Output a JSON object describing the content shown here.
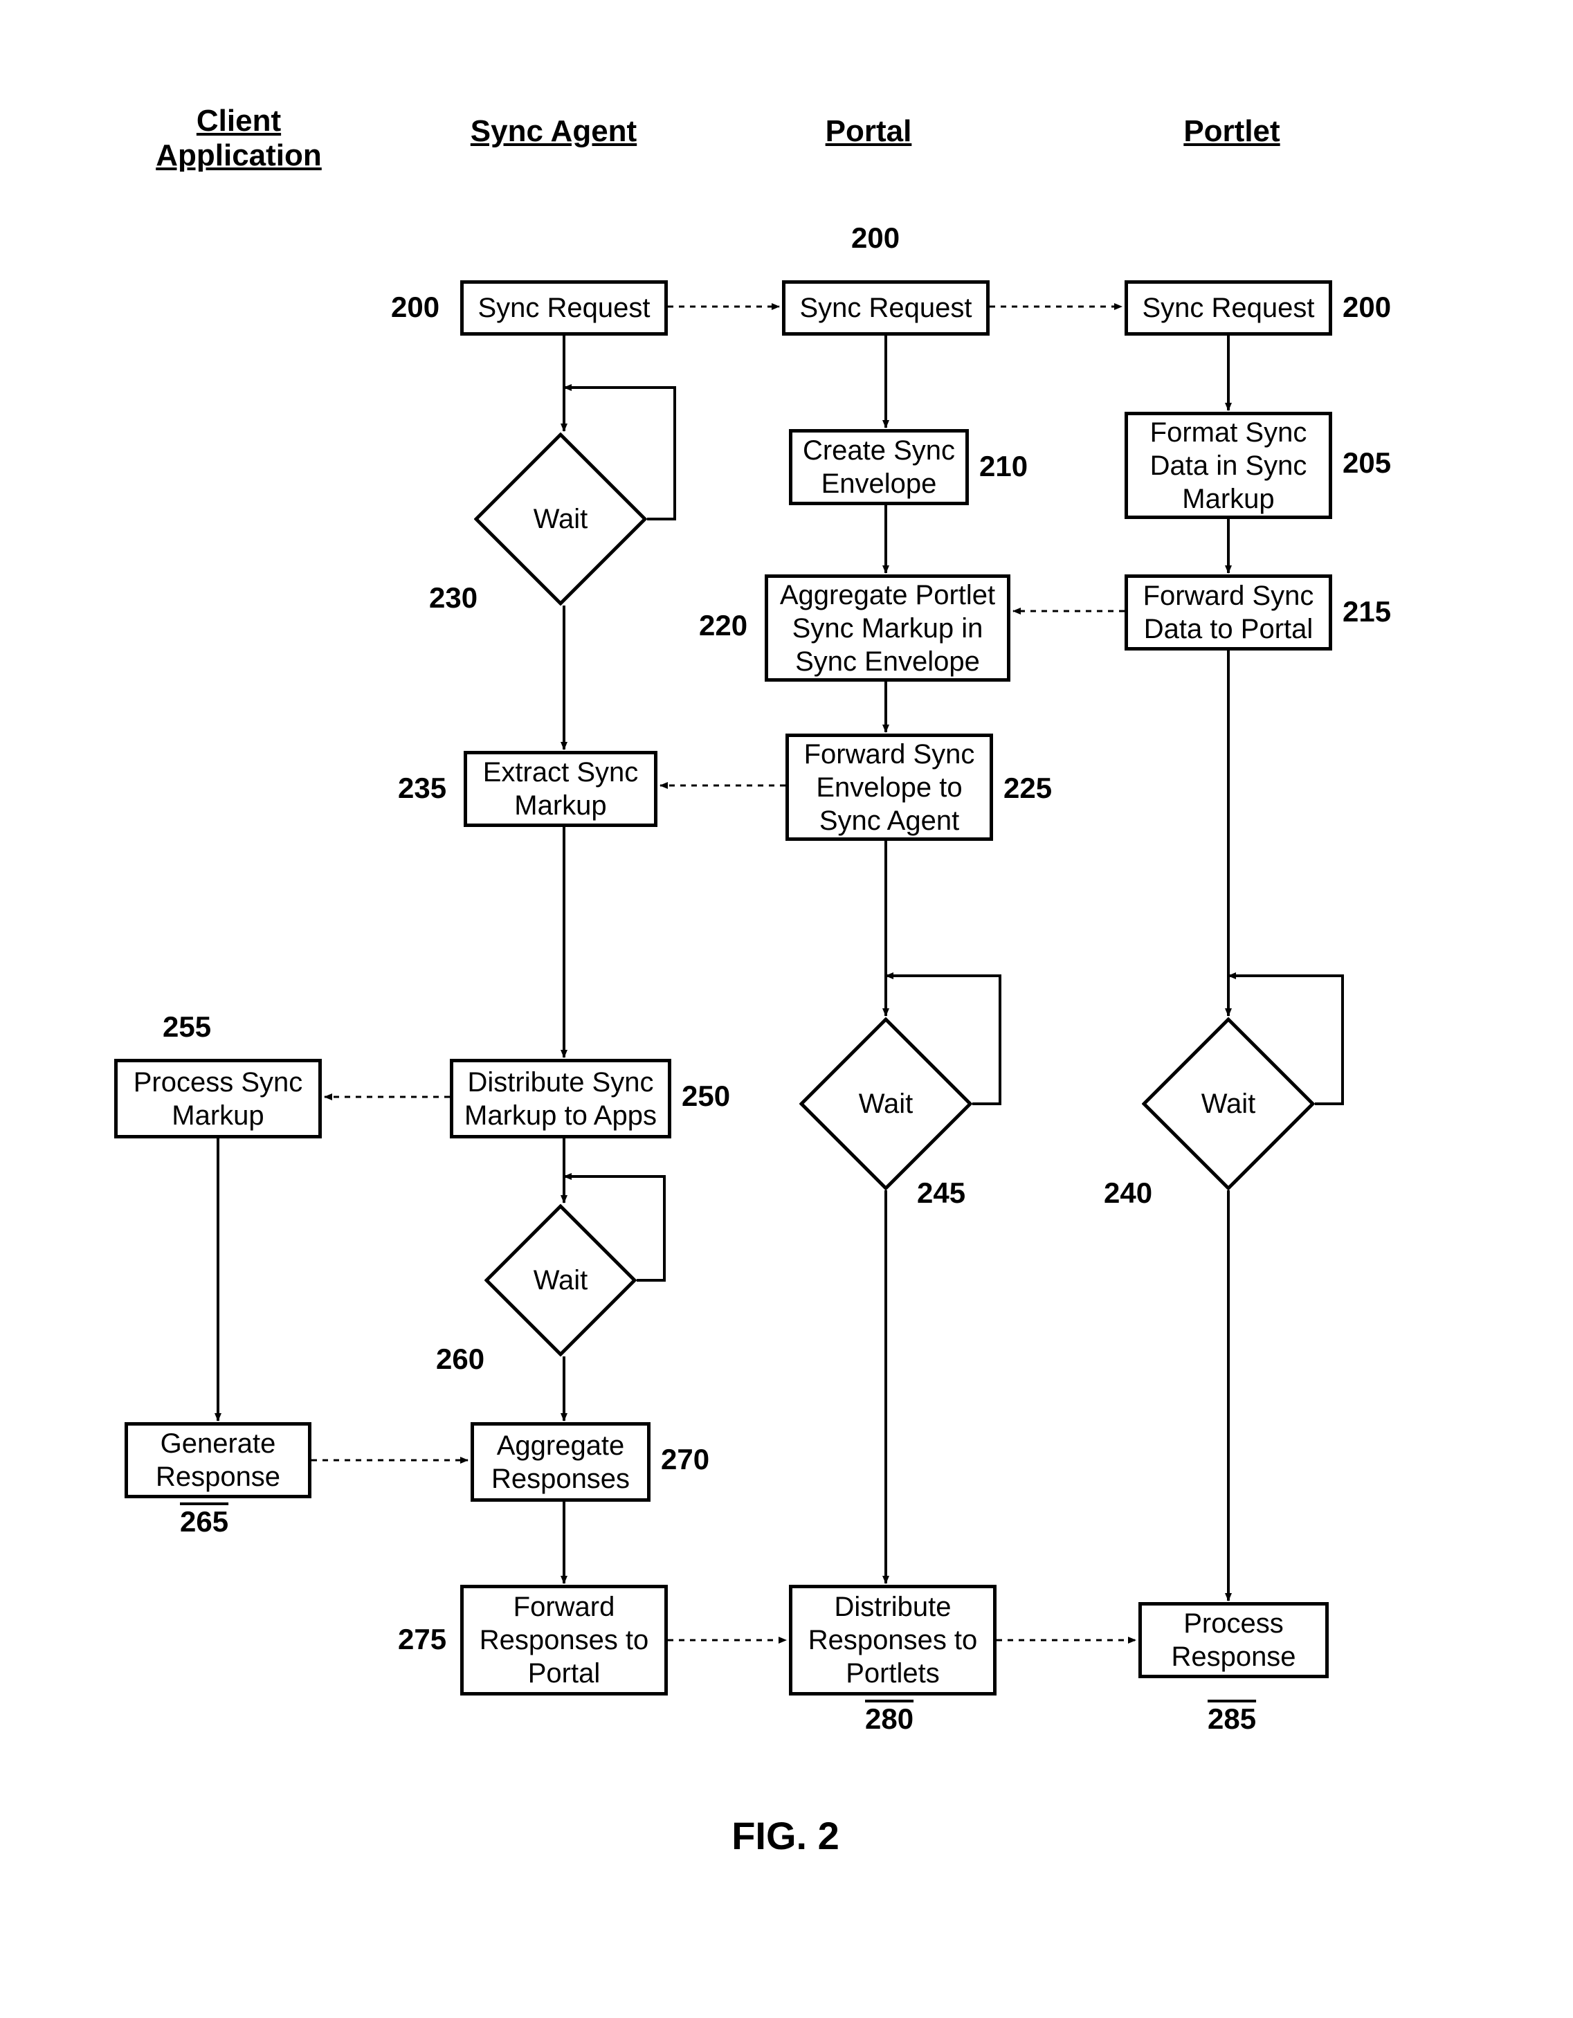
{
  "columns": {
    "client": "Client",
    "application": "Application",
    "syncAgent": "Sync Agent",
    "portal": "Portal",
    "portlet": "Portlet"
  },
  "boxes": {
    "b200a": "Sync Request",
    "b200b": "Sync Request",
    "b200c": "Sync Request",
    "b205": "Format Sync Data in Sync Markup",
    "b210": "Create Sync Envelope",
    "b215": "Forward Sync Data to Portal",
    "b220": "Aggregate Portlet Sync Markup in Sync Envelope",
    "b225": "Forward Sync Envelope to Sync Agent",
    "b235": "Extract Sync Markup",
    "b250": "Distribute Sync Markup to Apps",
    "b255": "Process Sync Markup",
    "b265": "Generate Response",
    "b270": "Aggregate Responses",
    "b275": "Forward Responses to Portal",
    "b280": "Distribute Responses to Portlets",
    "b285": "Process Response"
  },
  "diamonds": {
    "d230": "Wait",
    "d240": "Wait",
    "d245": "Wait",
    "d260": "Wait"
  },
  "labels": {
    "l200a": "200",
    "l200b": "200",
    "l200c": "200",
    "l205": "205",
    "l210": "210",
    "l215": "215",
    "l220": "220",
    "l225": "225",
    "l230": "230",
    "l235": "235",
    "l240": "240",
    "l245": "245",
    "l250": "250",
    "l255": "255",
    "l260": "260",
    "l265": "265",
    "l270": "270",
    "l275": "275",
    "l280": "280",
    "l285": "285"
  },
  "figure": "FIG. 2"
}
